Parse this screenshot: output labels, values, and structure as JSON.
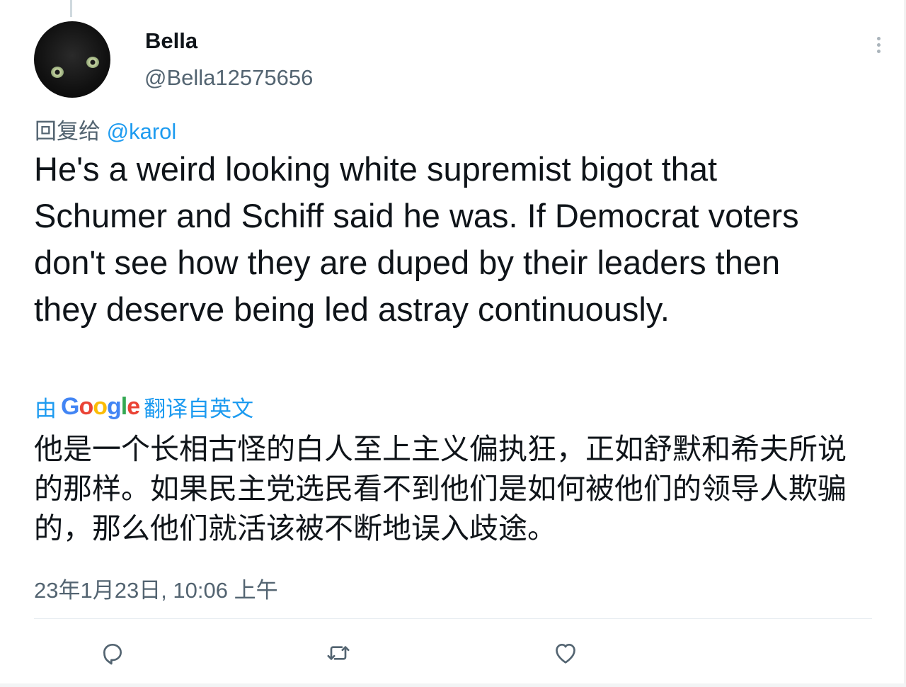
{
  "tweet": {
    "display_name": "Bella",
    "handle": "@Bella12575656",
    "reply_prefix": "回复给",
    "reply_mention": "@karol",
    "text": "He's a weird looking white supremist bigot that Schumer and Schiff said he was. If Democrat voters don't see how they are duped by their leaders then they deserve being led astray continuously.",
    "translation_prefix": "由",
    "translation_provider": "Google",
    "translation_suffix": "翻译自英文",
    "translated_text": "他是一个长相古怪的白人至上主义偏执狂，正如舒默和希夫所说的那样。如果民主党选民看不到他们是如何被他们的领导人欺骗的，那么他们就活该被不断地误入歧途。",
    "timestamp": "23年1月23日, 10:06 上午"
  },
  "icons": {
    "avatar": "black-cat-avatar",
    "more": "more-options-icon",
    "reply": "reply-icon",
    "retweet": "retweet-icon",
    "like": "like-icon"
  },
  "colors": {
    "accent": "#1d9bf0",
    "secondary_text": "#536471",
    "primary_text": "#0f1419",
    "divider": "#e6ecf0"
  }
}
